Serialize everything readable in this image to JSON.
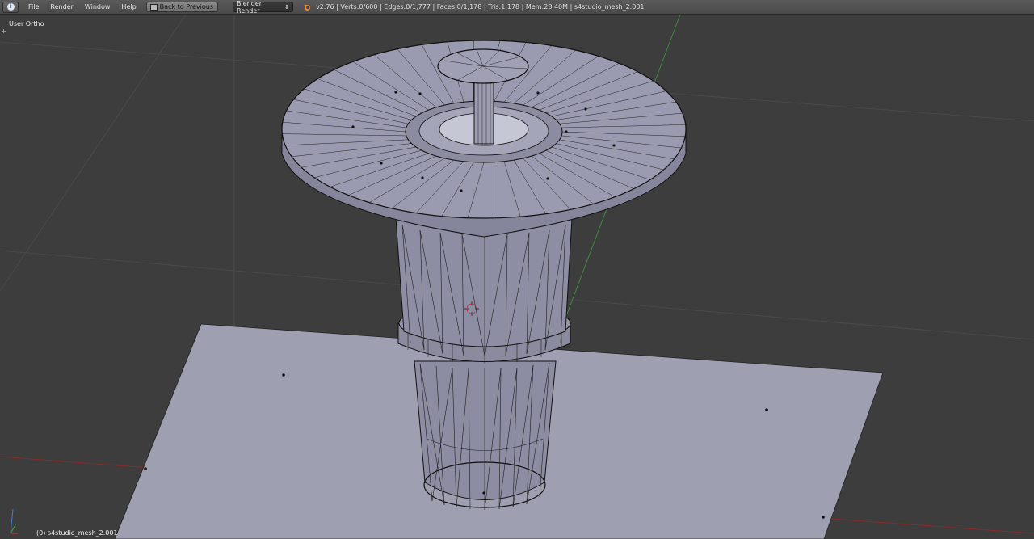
{
  "header": {
    "menus": [
      "File",
      "Render",
      "Window",
      "Help"
    ],
    "back_button": "Back to Previous",
    "render_engine": "Blender Render",
    "stats": "v2.76 | Verts:0/600 | Edges:0/1,777 | Faces:0/1,178 | Tris:1,178 | Mem:28.40M | s4studio_mesh_2.001"
  },
  "viewport": {
    "view_name": "User Ortho",
    "object_label": "(0) s4studio_mesh_2.001"
  },
  "colors": {
    "background": "#3d3d3d",
    "ground_plane": "#9ea0b2",
    "mesh": "#8a8ba0",
    "wire": "#111111",
    "x_axis": "#8a2a2a",
    "y_axis": "#3c8a3c"
  }
}
